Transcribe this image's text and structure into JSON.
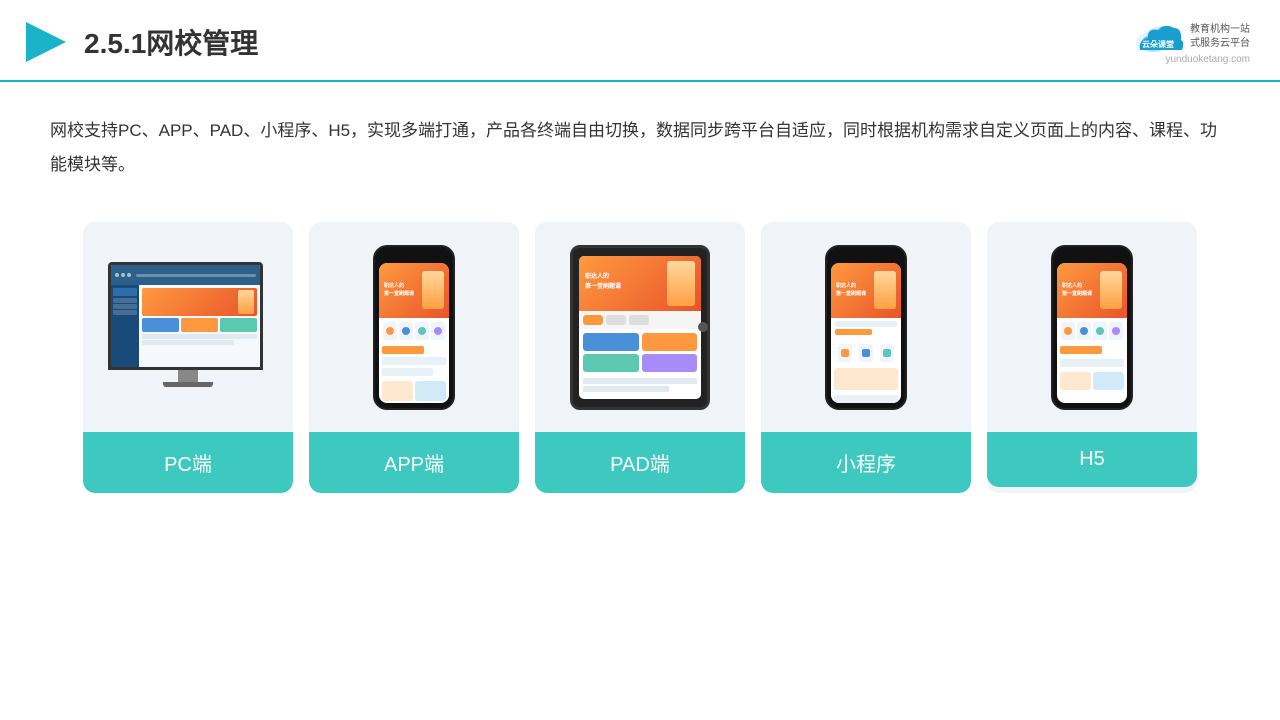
{
  "header": {
    "title": "2.5.1网校管理",
    "logo_brand": "云朵课堂",
    "logo_url": "yunduoketang.com",
    "logo_tagline1": "教育机构一站",
    "logo_tagline2": "式服务云平台"
  },
  "description": {
    "text": "网校支持PC、APP、PAD、小程序、H5，实现多端打通，产品各终端自由切换，数据同步跨平台自适应，同时根据机构需求自定义页面上的内容、课程、功能模块等。"
  },
  "cards": [
    {
      "id": "pc",
      "label": "PC端"
    },
    {
      "id": "app",
      "label": "APP端"
    },
    {
      "id": "pad",
      "label": "PAD端"
    },
    {
      "id": "miniprogram",
      "label": "小程序"
    },
    {
      "id": "h5",
      "label": "H5"
    }
  ],
  "colors": {
    "accent": "#3dc8c0",
    "header_border": "#1ab3c8",
    "card_bg": "#f0f4f8"
  }
}
